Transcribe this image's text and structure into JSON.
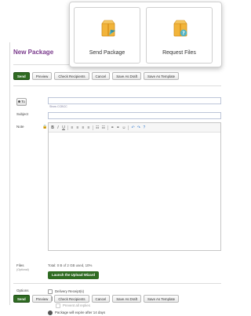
{
  "card": {
    "tiles": [
      {
        "label": "Send Package"
      },
      {
        "label": "Request Files"
      }
    ]
  },
  "form": {
    "title": "New Package",
    "toolbar": [
      "Send",
      "Preview",
      "Check Recipients",
      "Cancel",
      "Save As Draft",
      "Save As Template"
    ],
    "to_label": "To",
    "email_hint": "Show CCBCC",
    "subject_label": "Subject",
    "note_label": "Note",
    "editor_tools": [
      "B",
      "I",
      "U",
      "≡",
      "≡",
      "≡",
      "≡",
      "☷",
      "☷",
      "⚭",
      "⚭",
      "☺",
      "↶",
      "↷",
      "?"
    ],
    "files_label": "Files",
    "files_sublabel": "(Optional)",
    "files_note": "Total: 0 B of 2 GB used, 10%",
    "launch_label": "Launch the Upload Wizard",
    "options_label": "Options",
    "options": [
      {
        "label": "Delivery Receipt(s)",
        "type": "checkbox",
        "checked": false,
        "indent": false
      },
      {
        "label": "Prevent \"Reply All\"",
        "type": "checkbox",
        "checked": false,
        "indent": false
      },
      {
        "label": "Prevent all replies",
        "type": "checkbox",
        "checked": false,
        "indent": true
      },
      {
        "label": "Package will expire after 14 days",
        "type": "radio",
        "checked": true,
        "indent": false
      }
    ]
  },
  "colors": {
    "brand_green": "#2f6b22",
    "title_purple": "#7a3a8c",
    "package_orange": "#f2b43a",
    "arrow_teal": "#4fb3c4"
  }
}
